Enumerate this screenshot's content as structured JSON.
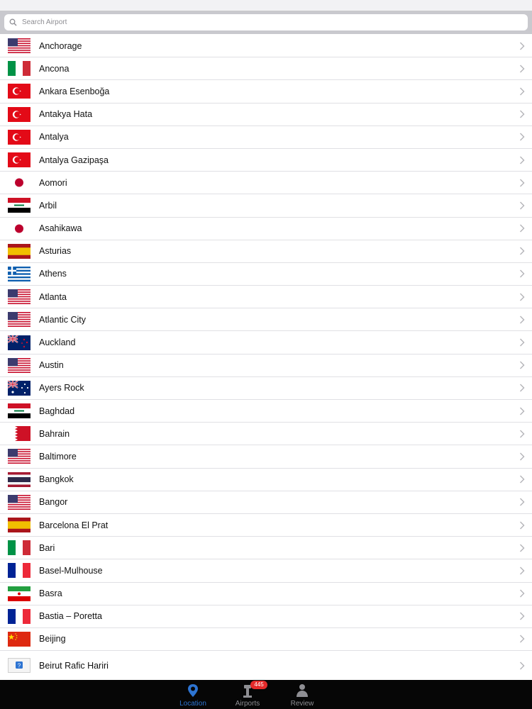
{
  "search": {
    "placeholder": "Search Airport",
    "icon": "search-icon"
  },
  "airports": [
    {
      "name": "Anchorage",
      "flag": "us"
    },
    {
      "name": "Ancona",
      "flag": "it"
    },
    {
      "name": "Ankara Esenboğa",
      "flag": "tr"
    },
    {
      "name": "Antakya Hata",
      "flag": "tr"
    },
    {
      "name": "Antalya",
      "flag": "tr"
    },
    {
      "name": "Antalya Gazipaşa",
      "flag": "tr"
    },
    {
      "name": "Aomori",
      "flag": "jp"
    },
    {
      "name": "Arbil",
      "flag": "iq"
    },
    {
      "name": "Asahikawa",
      "flag": "jp"
    },
    {
      "name": "Asturias",
      "flag": "es"
    },
    {
      "name": "Athens",
      "flag": "gr"
    },
    {
      "name": "Atlanta",
      "flag": "us"
    },
    {
      "name": "Atlantic City",
      "flag": "us"
    },
    {
      "name": "Auckland",
      "flag": "nz"
    },
    {
      "name": "Austin",
      "flag": "us"
    },
    {
      "name": "Ayers Rock",
      "flag": "au"
    },
    {
      "name": "Baghdad",
      "flag": "iq"
    },
    {
      "name": "Bahrain",
      "flag": "bh"
    },
    {
      "name": "Baltimore",
      "flag": "us"
    },
    {
      "name": "Bangkok",
      "flag": "th"
    },
    {
      "name": "Bangor",
      "flag": "us"
    },
    {
      "name": "Barcelona El Prat",
      "flag": "es"
    },
    {
      "name": "Bari",
      "flag": "it"
    },
    {
      "name": "Basel-Mulhouse",
      "flag": "fr"
    },
    {
      "name": "Basra",
      "flag": "ir"
    },
    {
      "name": "Bastia – Poretta",
      "flag": "fr"
    },
    {
      "name": "Beijing",
      "flag": "cn"
    },
    {
      "name": "Beirut Rafic Hariri",
      "flag": "unknown"
    }
  ],
  "tabs": [
    {
      "label": "Location",
      "icon": "location-pin-icon",
      "active": true
    },
    {
      "label": "Airports",
      "icon": "tower-icon",
      "badge": "445"
    },
    {
      "label": "Review",
      "icon": "reviewer-icon"
    }
  ],
  "colors": {
    "accent": "#2d74d2",
    "badge": "#e42a2a",
    "tabbar": "#060606"
  }
}
